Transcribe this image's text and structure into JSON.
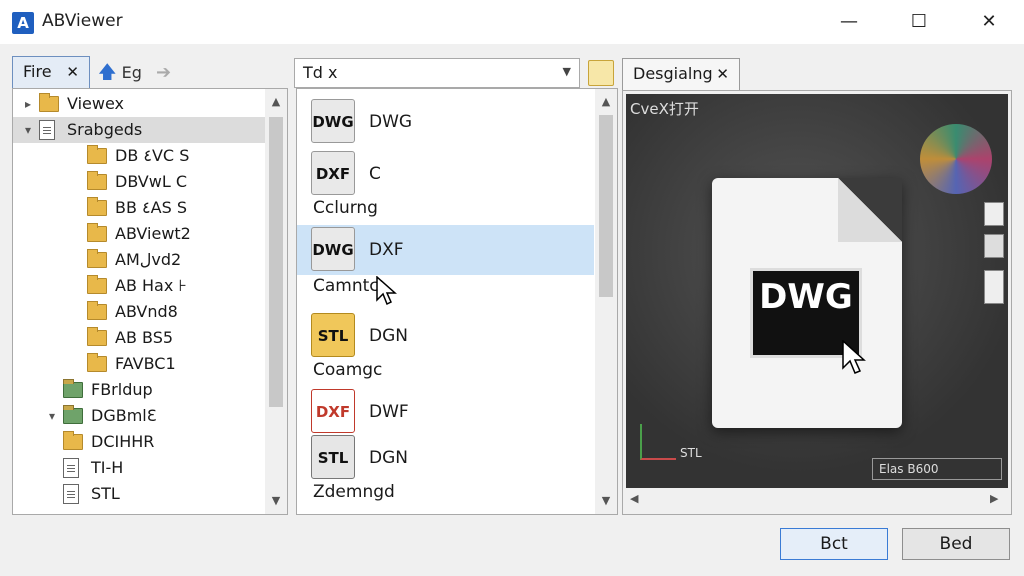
{
  "window": {
    "title": "ABViewer",
    "app_icon_letter": "A"
  },
  "window_controls": {
    "minimize": "—",
    "maximize": "☐",
    "close": "✕"
  },
  "left_panel": {
    "tab_label": "Fire",
    "toolbar": {
      "back_label": "Eg",
      "up_arrow": "🡅",
      "forward_arrow": "➔"
    },
    "tree": [
      {
        "label": "Viewex",
        "type": "folder",
        "indent": 0,
        "expander": "▸"
      },
      {
        "label": "Srabgeds",
        "type": "doc-folder",
        "indent": 0,
        "expander": "▾",
        "selected": true
      },
      {
        "label": "DB ٤VC S",
        "type": "folder",
        "indent": 2
      },
      {
        "label": "DBVwL C",
        "type": "folder",
        "indent": 2
      },
      {
        "label": "BB ٤AS S",
        "type": "folder",
        "indent": 2
      },
      {
        "label": "ABViewt2",
        "type": "folder",
        "indent": 2
      },
      {
        "label": "AMلvd2",
        "type": "folder",
        "indent": 2
      },
      {
        "label": "AB Hax ⊦",
        "type": "folder",
        "indent": 2
      },
      {
        "label": "ABVnd8",
        "type": "folder",
        "indent": 2
      },
      {
        "label": "AB BS5",
        "type": "folder",
        "indent": 2
      },
      {
        "label": "FAVBC1",
        "type": "folder",
        "indent": 2
      },
      {
        "label": "FBrldup",
        "type": "green-folder",
        "indent": 1
      },
      {
        "label": "DGBmlƐ",
        "type": "green-folder",
        "indent": 1,
        "expander": "▾"
      },
      {
        "label": "DCIHHR",
        "type": "folder",
        "indent": 1
      },
      {
        "label": "TI-H",
        "type": "file",
        "indent": 1
      },
      {
        "label": "STL",
        "type": "file",
        "indent": 1
      }
    ]
  },
  "middle_panel": {
    "dropdown_value": "Td x",
    "dropdown_arrow": "▼",
    "items": [
      {
        "icon_text": "DWG",
        "icon_style": "dwg",
        "name": "DWG"
      },
      {
        "icon_text": "DXF",
        "icon_style": "dwg",
        "name": "C"
      },
      {
        "category": "Cclurng"
      },
      {
        "icon_text": "DWG",
        "icon_style": "dwg",
        "name": "DXF",
        "selected": true
      },
      {
        "category": "Camntc"
      },
      {
        "icon_text": "STL",
        "icon_style": "stl",
        "name": "DGN"
      },
      {
        "category": "Coamgc"
      },
      {
        "icon_text": "DXF",
        "icon_style": "dxf",
        "name": "DWF"
      },
      {
        "icon_text": "STL",
        "icon_style": "stl2",
        "name": "DGN"
      },
      {
        "category": "Zdemngd"
      }
    ]
  },
  "preview_panel": {
    "tab_label": "Desgialng",
    "overlay_label": "CveX打开",
    "badge_text": "DWG",
    "axis_label": "STL",
    "status_text": "Elas      B600"
  },
  "footer": {
    "ok_label": "Bct",
    "cancel_label": "Bed"
  },
  "colors": {
    "accent": "#1f5fbf",
    "selection": "#cde3f7",
    "preview_bg": "#3b3b3b"
  }
}
